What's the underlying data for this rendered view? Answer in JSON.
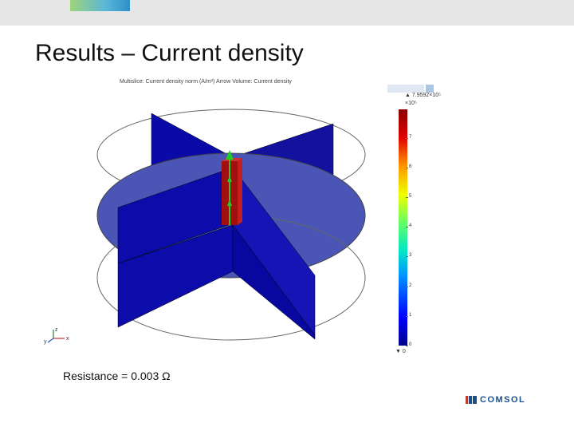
{
  "slide": {
    "title": "Results – Current density",
    "result": "Resistance = 0.003 Ω"
  },
  "plot": {
    "caption": "Multislice: Current density norm (A/m²)  Arrow Volume: Current density",
    "colorbar": {
      "max_label": "▲ 7.9592×10⁵",
      "exponent": "×10⁵",
      "min_label": "▼ 0",
      "ticks": [
        "7",
        "6",
        "5",
        "4",
        "3",
        "2",
        "1",
        "0"
      ],
      "tick_values": [
        7,
        6,
        5,
        4,
        3,
        2,
        1,
        0
      ],
      "range": [
        0,
        7.9592
      ]
    },
    "axes": {
      "x": "x",
      "y": "y",
      "z": "z"
    }
  },
  "brand": {
    "logo_text": "COMSOL",
    "colors": {
      "primary": "#1a4f8b",
      "accent": "#c0392b",
      "slice_blue": "#0a0aa8",
      "plane_blue": "#4a55b5"
    }
  }
}
